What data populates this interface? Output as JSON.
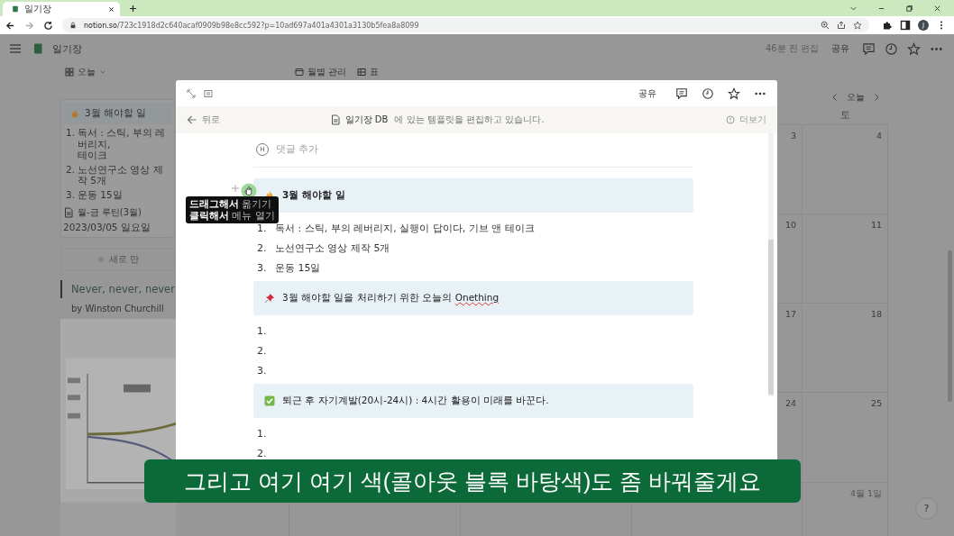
{
  "browser": {
    "tab": {
      "title": "일기장"
    },
    "url": {
      "host": "notion.so",
      "path": "/723c1918d2c640acaf0909b98e8cc592?p=10ad697a401a4301a3130b5fea8a8099"
    },
    "forward_disabled": true,
    "profile": "J"
  },
  "topbar": {
    "title": "일기장",
    "edited": "46분 전 편집",
    "share": "공유"
  },
  "database": {
    "view": "오늘",
    "views": [
      {
        "kind": "calendar",
        "label": "월별 관리"
      },
      {
        "kind": "table",
        "label": "표"
      }
    ],
    "card": {
      "callout": {
        "text": "3월 해야할 일"
      },
      "items": [
        {
          "number": "1.",
          "lines": [
            "독서 : 스틱, 부의 레버리지,",
            "테이크"
          ]
        },
        {
          "number": "2.",
          "lines": [
            "노선연구소 영상 제작 5개"
          ]
        },
        {
          "number": "3.",
          "lines": [
            "운동 15일"
          ]
        }
      ],
      "title": "월-금 루틴(3월)",
      "date": "2023/03/05 일요일"
    },
    "new_button": "새로 만",
    "quote": {
      "text": "Never, never, never",
      "author": "by Winston Churchill"
    }
  },
  "calendar": {
    "today": "오늘",
    "weekday": "토",
    "weeks": [
      {
        "friday": "3",
        "saturday": "4",
        "next_month": false
      },
      {
        "friday": "10",
        "saturday": "11",
        "next_month": false
      },
      {
        "friday": "17",
        "saturday": "18",
        "next_month": false
      },
      {
        "friday": "24",
        "saturday": "25",
        "next_month": false
      },
      {
        "saturday": "4월 1일",
        "next_month": true
      }
    ]
  },
  "modal": {
    "share": "공유",
    "banner": {
      "back": "뒤로",
      "database": "일기장 DB",
      "message": "에 있는 템플릿을 편집하고 있습니다.",
      "more": "더보기"
    },
    "comment": {
      "avatar": "H",
      "label": "댓글 추가"
    },
    "tooltip": [
      "**드래그해서** 옮기기",
      "**클릭해서** 메뉴 열기"
    ],
    "blocks": [
      {
        "kind": "callout",
        "text": "3월 해야할 일",
        "bold": true,
        "hovered": true
      },
      {
        "kind": "numbered",
        "number": "1.",
        "text": "독서 : 스틱, 부의 레버리지, 실행이 답이다, 기브 앤 테이크",
        "hovered": false
      },
      {
        "kind": "numbered",
        "number": "2.",
        "text": "노선연구소 영상 제작 5개",
        "hovered": false
      },
      {
        "kind": "numbered",
        "number": "3.",
        "text": "운동 15일",
        "hovered": false
      },
      {
        "kind": "callout",
        "text": "3월 해야할 일을 처리하기 위한 오늘의 ",
        "flagged": "Onething",
        "bold": false,
        "hovered": false
      },
      {
        "kind": "numbered",
        "number": "1.",
        "hovered": false
      },
      {
        "kind": "numbered",
        "number": "2.",
        "hovered": false
      },
      {
        "kind": "numbered",
        "number": "3.",
        "hovered": false
      },
      {
        "kind": "callout",
        "text": "퇴근 후 자기계발(20시-24시) : 4시간 활용이 미래를 바꾼다.",
        "bold": false,
        "hovered": false
      },
      {
        "kind": "numbered",
        "number": "1.",
        "hovered": false
      },
      {
        "kind": "numbered",
        "number": "2.",
        "hovered": false
      }
    ]
  },
  "subtitle": "그리고 여기 여기 색(콜아웃 블록 바탕색)도 좀 바꿔줄게요",
  "help": "?"
}
